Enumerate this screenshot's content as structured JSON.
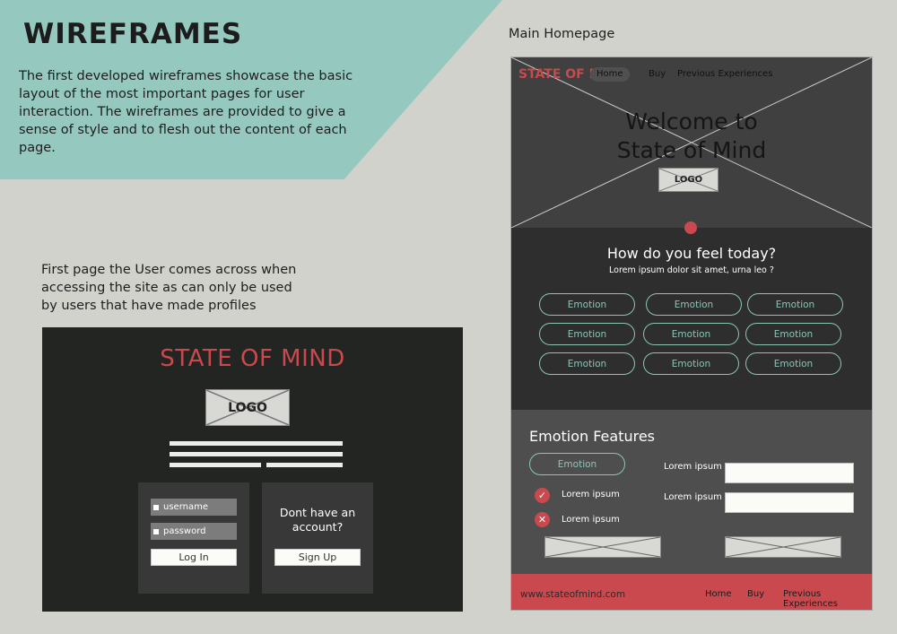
{
  "page": {
    "title": "WIREFRAMES",
    "intro": "The first developed wireframes showcase the basic layout of the most important pages for user interaction. The wireframes are provided to give a sense of style and to flesh out the content of each page.",
    "login_description": "First page the User comes across when accessing the site as can only be used by users that have made profiles",
    "homepage_caption": "Main Homepage"
  },
  "login": {
    "brand": "STATE OF MIND",
    "logo": "LOGO",
    "username_placeholder": "username",
    "password_placeholder": "password",
    "login_button": "Log In",
    "no_account": "Dont have an account?",
    "signup_button": "Sign Up"
  },
  "homepage": {
    "brand": "STATE OF MIND",
    "nav": [
      "Home",
      "Buy",
      "Previous Experiences"
    ],
    "welcome_line1": "Welcome to",
    "welcome_line2": "State of Mind",
    "logo": "LOGO",
    "feel_title": "How do you feel today?",
    "feel_subtitle": "Lorem ipsum dolor sit amet, urna leo ?",
    "emotions": [
      "Emotion",
      "Emotion",
      "Emotion",
      "Emotion",
      "Emotion",
      "Emotion",
      "Emotion",
      "Emotion",
      "Emotion"
    ],
    "features": {
      "title": "Emotion Features",
      "pill": "Emotion",
      "items": [
        "Lorem ipsum",
        "Lorem ipsum"
      ],
      "field_labels": [
        "Lorem ipsum",
        "Lorem ipsum"
      ]
    },
    "footer": {
      "url": "www.stateofmind.com",
      "links": [
        "Home",
        "Buy",
        "Previous Experiences"
      ]
    }
  },
  "colors": {
    "background": "#d2d2cc",
    "teal": "#95c9bf",
    "accent_red": "#c9494e",
    "dark": "#232523"
  }
}
